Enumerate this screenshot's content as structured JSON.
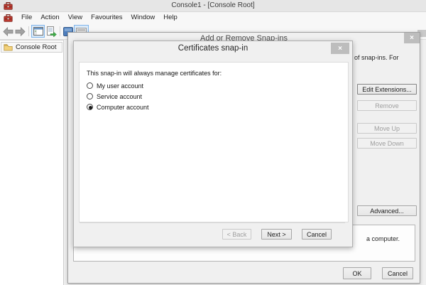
{
  "window": {
    "title": "Console1 - [Console Root]",
    "menu": [
      "File",
      "Action",
      "View",
      "Favourites",
      "Window",
      "Help"
    ],
    "tree_root": "Console Root",
    "toolbar_icons": [
      "back-icon",
      "forward-icon",
      "show-tree-icon",
      "export-list-icon",
      "help-icon",
      "toolbar-toggle-icon"
    ]
  },
  "snapins_dialog": {
    "title": "Add or Remove Snap-ins",
    "close_glyph": "×",
    "intro_fragment": "of snap-ins. For",
    "edit_extensions": "Edit Extensions...",
    "remove": "Remove",
    "move_up": "Move Up",
    "move_down": "Move Down",
    "advanced": "Advanced...",
    "description_fragment": "a computer.",
    "ok": "OK",
    "cancel": "Cancel"
  },
  "certificates_dialog": {
    "title": "Certificates snap-in",
    "close_glyph": "×",
    "prompt": "This snap-in will always manage certificates for:",
    "options": [
      {
        "label": "My user account",
        "selected": false
      },
      {
        "label": "Service account",
        "selected": false
      },
      {
        "label": "Computer account",
        "selected": true
      }
    ],
    "back": "< Back",
    "next": "Next >",
    "cancel": "Cancel"
  },
  "colors": {
    "selection_accent": "#7eb4ea",
    "dialog_bg": "#f0f0f0",
    "close_button_bg": "#bdbdbd",
    "mmc_icon_red": "#bd3a30",
    "folder_yellow": "#f3d27c",
    "export_arrow_green": "#3fae49"
  }
}
